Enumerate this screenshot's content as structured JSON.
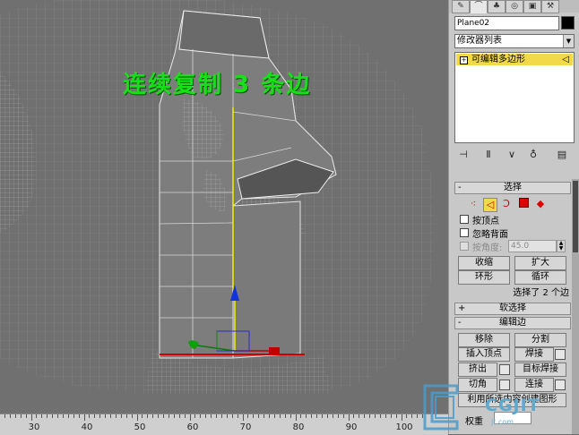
{
  "viewport": {
    "overlay_text": "连续复制 3 条边"
  },
  "ruler": {
    "labels": [
      "30",
      "40",
      "50",
      "60",
      "70",
      "80",
      "90",
      "100"
    ]
  },
  "panel": {
    "tabs": [
      "create-icon",
      "modify-icon",
      "hierarchy-icon",
      "motion-icon",
      "display-icon",
      "utilities-icon"
    ],
    "object_name": "Plane02",
    "object_color": "#000000",
    "modifier_list_label": "修改器列表",
    "stack_item_label": "可编辑多边形",
    "selection": {
      "title": "选择",
      "sign": "-",
      "by_vertex": "按顶点",
      "ignore_backfacing": "忽略背面",
      "by_angle": "按角度:",
      "angle_value": "45.0",
      "shrink": "收缩",
      "grow": "扩大",
      "ring": "环形",
      "loop": "循环",
      "count_text": "选择了 2 个边"
    },
    "soft_selection": {
      "title": "软选择",
      "sign": "+"
    },
    "edit_edges": {
      "title": "编辑边",
      "sign": "-",
      "remove": "移除",
      "split": "分割",
      "insert_vertex": "插入顶点",
      "weld": "焊接",
      "extrude": "挤出",
      "target_weld": "目标焊接",
      "chamfer": "切角",
      "connect": "连接",
      "create_shape": "利用所选内容创建图形",
      "weight_label": "权重"
    }
  },
  "watermark": {
    "text": "CGJIT",
    "sub": "jt.com"
  },
  "colors": {
    "overlay_green": "#18e018",
    "stack_highlight": "#f2d94a",
    "active_gizmo": "#f2f200"
  }
}
